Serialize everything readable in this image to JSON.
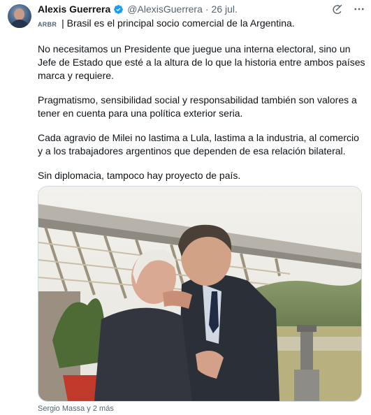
{
  "tweet": {
    "author_name": "Alexis Guerrera",
    "verified_icon": "verified-badge-icon",
    "handle": "@AlexisGuerrera",
    "separator": "·",
    "date": "26 jul.",
    "translation_tag": "ARBR",
    "paragraphs": [
      "Brasil es el principal socio comercial de la Argentina.",
      "No necesitamos un Presidente que juegue una interna electoral, sino un Jefe de Estado que esté a la altura de lo que la historia entre ambos países marca y requiere.",
      "Pragmatismo, sensibilidad social y responsabilidad también son valores a tener en cuenta para una política exterior seria.",
      "Cada agravio de Milei no lastima a Lula, lastima a la industria, al comercio y a los trabajadores argentinos que dependen de esa relación bilateral.",
      "Sin diplomacia, tampoco hay proyecto de país."
    ],
    "first_line_rest": " | Brasil es el principal socio comercial de la Argentina.",
    "tagged_users": "Sergio Massa y 2 más"
  },
  "icons": {
    "grok": "grok-icon",
    "more": "more-options-icon"
  },
  "colors": {
    "verified": "#1d9bf0",
    "secondary_text": "#536471",
    "primary_text": "#0f1419"
  }
}
